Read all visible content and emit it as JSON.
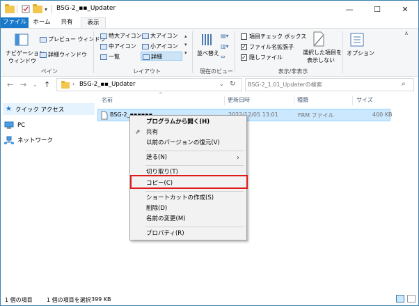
{
  "window": {
    "title": "BSG-2_▪▪_Updater"
  },
  "title_buttons": {
    "minimize": "—",
    "maximize": "☐",
    "close": "✕"
  },
  "tabs": [
    {
      "label": "ファイル"
    },
    {
      "label": "ホーム"
    },
    {
      "label": "共有"
    },
    {
      "label": "表示"
    }
  ],
  "ribbon": {
    "pane": {
      "nav_pane_line1": "ナビゲーション",
      "nav_pane_line2": "ウィンドウ",
      "preview": "プレビュー ウィンドウ",
      "details": "詳細ウィンドウ",
      "group": "ペイン"
    },
    "layout": {
      "extra_large": "特大アイコン",
      "large": "大アイコン",
      "medium": "中アイコン",
      "small": "小アイコン",
      "list": "一覧",
      "details": "詳細",
      "group": "レイアウト"
    },
    "current_view": {
      "sort": "並べ替え",
      "group": "現在のビュー"
    },
    "show_hide": {
      "item_checkboxes": "項目チェック ボックス",
      "file_ext": "ファイル名拡張子",
      "hidden_files": "隠しファイル",
      "hide_selected_line1": "選択した項目を",
      "hide_selected_line2": "表示しない",
      "group": "表示/非表示"
    },
    "options": "オプション"
  },
  "navbar": {
    "address": "BSG-2_▪▪_Updater",
    "search_placeholder": "BSG-2_1.01_Updaterの検索"
  },
  "nav_pane": [
    {
      "label": "クイック アクセス"
    },
    {
      "label": "PC"
    },
    {
      "label": "ネットワーク"
    }
  ],
  "columns": {
    "name": "名前",
    "date": "更新日時",
    "type": "種類",
    "size": "サイズ"
  },
  "file": {
    "name": "BSG-2_▪▪▪▪▪▪",
    "date": "2022/12/05 13:01",
    "type": "FRM ファイル",
    "size": "400 KB"
  },
  "context_menu": {
    "open_with": "プログラムから開く(H)",
    "share": "共有",
    "restore": "以前のバージョンの復元(V)",
    "send_to": "送る(N)",
    "cut": "切り取り(T)",
    "copy": "コピー(C)",
    "shortcut": "ショートカットの作成(S)",
    "delete": "削除(D)",
    "rename": "名前の変更(M)",
    "properties": "プロパティ(R)"
  },
  "status": {
    "items": "1 個の項目",
    "selected": "1 個の項目を選択",
    "size": "399 KB"
  },
  "colors": {
    "file_tab": "#1979ca",
    "selection": "#cce8ff",
    "highlight_box": "#e01a1a"
  }
}
